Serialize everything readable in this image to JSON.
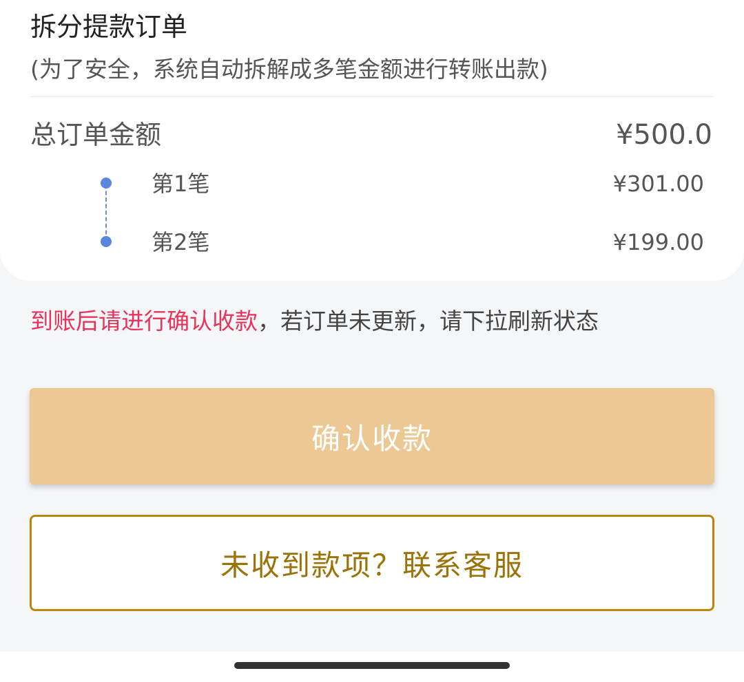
{
  "card": {
    "title": "拆分提款订单",
    "subtitle": "(为了安全，系统自动拆解成多笔金额进行转账出款)",
    "total": {
      "label": "总订单金额",
      "amount": "¥500.0"
    },
    "installments": [
      {
        "label": "第1笔",
        "amount": "¥301.00"
      },
      {
        "label": "第2笔",
        "amount": "¥199.00"
      }
    ]
  },
  "notice": {
    "highlight": "到账后请进行确认收款",
    "rest": "，若订单未更新，请下拉刷新状态",
    "highlight_color": "#e8325a"
  },
  "actions": {
    "confirm_label": "确认收款",
    "contact_label": "未收到款项？联系客服"
  },
  "colors": {
    "confirm_button": "#ecc895",
    "contact_border": "#b8860b",
    "timeline_dot": "#5b86e0",
    "page_background": "#f5f6f8"
  }
}
